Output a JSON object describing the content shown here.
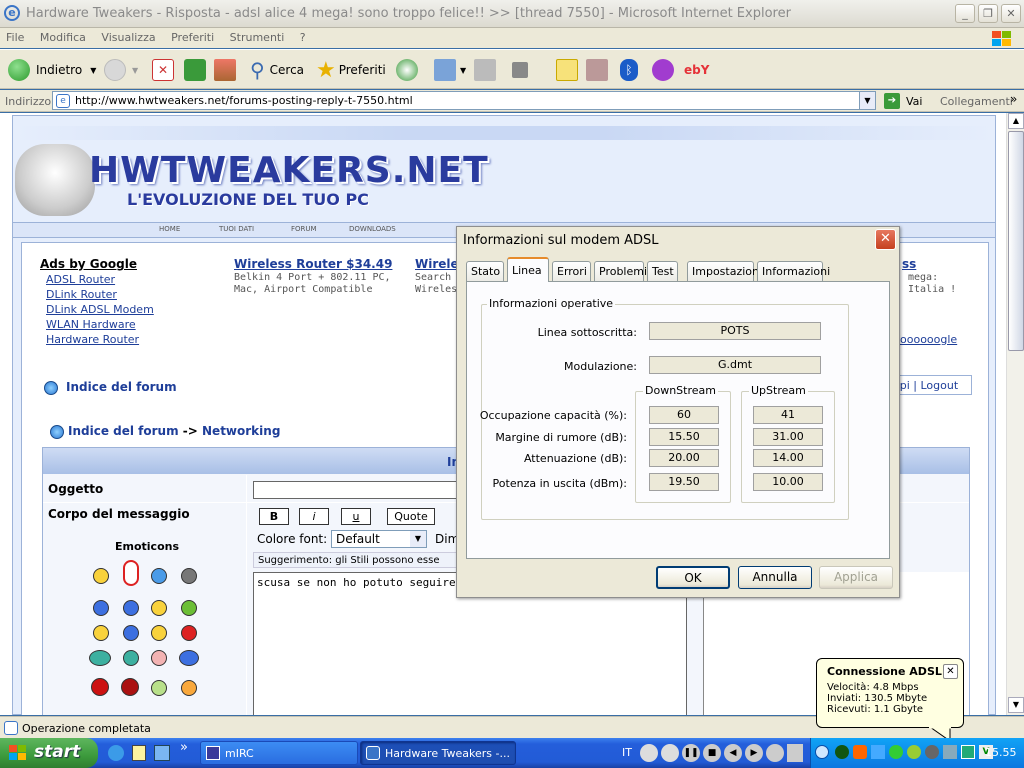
{
  "window": {
    "title": "Hardware Tweakers - Risposta - adsl alice 4 mega! sono troppo felice!! >> [thread 7550] - Microsoft Internet Explorer",
    "menu": [
      "File",
      "Modifica",
      "Visualizza",
      "Preferiti",
      "Strumenti",
      "?"
    ]
  },
  "toolbar": {
    "back": "Indietro",
    "search": "Cerca",
    "favorites": "Preferiti"
  },
  "address": {
    "label": "Indirizzo",
    "url": "http://www.hwtweakers.net/forums-posting-reply-t-7550.html",
    "go": "Vai",
    "links": "Collegamenti"
  },
  "site": {
    "logo_main": "HWTWEAKERS.NET",
    "logo_sub": "L'EVOLUZIONE DEL TUO PC",
    "nav": [
      "HOME",
      "TUOI DATI",
      "FORUM",
      "DOWNLOADS"
    ],
    "ads_title": "Ads by Google",
    "ads": [
      "ADSL Router",
      "DLink Router",
      "DLink ADSL Modem",
      "WLAN Hardware",
      "Hardware Router"
    ],
    "ad1_title": "Wireless Router $34.49",
    "ad1_text1": "Belkin 4 Port + 802.11 PC,",
    "ad1_text2": "Mac, Airport Compatible",
    "ad2_title": "Wirele",
    "ad2_text1": "Search",
    "ad2_text2": "Wireles",
    "ad3_title": "ss",
    "ad3_text1": "mega:",
    "ad3_text2": "Italia !",
    "ooogle": "oooooogle",
    "forum_index": "Indice del forum",
    "breadcrumb_sep": "->",
    "breadcrumb_cat": "Networking",
    "user_links": "opi | Logout",
    "subject_label": "Oggetto",
    "body_label": "Corpo del messaggio",
    "emoticons_label": "Emoticons",
    "fmt_b": "B",
    "fmt_i": "i",
    "fmt_u": "u",
    "fmt_quote": "Quote",
    "font_color_label": "Colore font:",
    "font_color_value": "Default",
    "dim_label": "Dim",
    "tip": "Suggerimento: gli Stili possono esse",
    "message_text": "scusa se non ho potuto seguire il fo",
    "header_fragment": "In"
  },
  "dialog": {
    "title": "Informazioni sul modem ADSL",
    "tabs": [
      "Stato",
      "Linea",
      "Errori",
      "Problemi",
      "Test",
      "Impostazioni",
      "Informazioni"
    ],
    "active_tab": "Linea",
    "group_title": "Informazioni operative",
    "line_label": "Linea sottoscritta:",
    "line_value": "POTS",
    "mod_label": "Modulazione:",
    "mod_value": "G.dmt",
    "down_title": "DownStream",
    "up_title": "UpStream",
    "rows": [
      {
        "label": "Occupazione capacità (%):",
        "down": "60",
        "up": "41"
      },
      {
        "label": "Margine di rumore (dB):",
        "down": "15.50",
        "up": "31.00"
      },
      {
        "label": "Attenuazione (dB):",
        "down": "20.00",
        "up": "14.00"
      },
      {
        "label": "Potenza in uscita (dBm):",
        "down": "19.50",
        "up": "10.00"
      }
    ],
    "ok": "OK",
    "cancel": "Annulla",
    "apply": "Applica"
  },
  "balloon": {
    "title": "Connessione ADSL",
    "speed": "Velocità: 4.8 Mbps",
    "sent": "Inviati: 130.5 Mbyte",
    "received": "Ricevuti: 1.1 Gbyte"
  },
  "status": {
    "text": "Operazione completata"
  },
  "taskbar": {
    "start": "start",
    "task1": "mIRC",
    "task2": "Hardware Tweakers -...",
    "lang": "IT",
    "clock": "15.55"
  }
}
